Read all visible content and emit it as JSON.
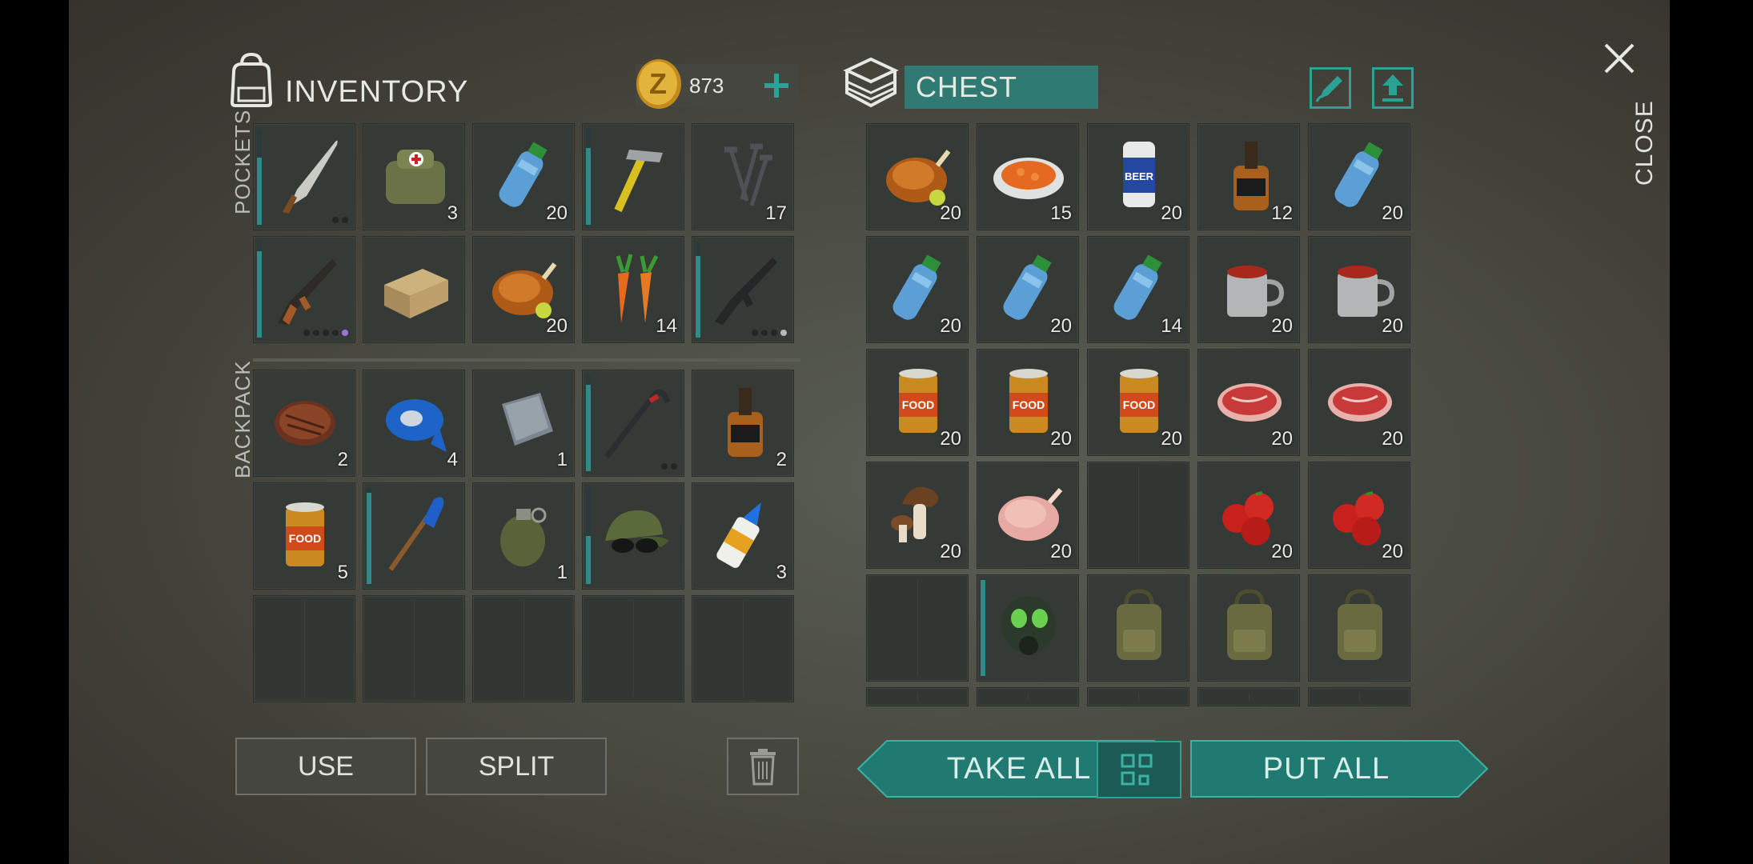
{
  "inventory": {
    "title": "INVENTORY",
    "coins": "873",
    "pockets_label": "POCKETS",
    "backpack_label": "BACKPACK",
    "pockets": [
      {
        "icon": "machete-icon",
        "count": "",
        "durability": 0.7,
        "dots": [
          "off",
          "off"
        ]
      },
      {
        "icon": "medkit-bag-icon",
        "count": "3"
      },
      {
        "icon": "water-bottle-icon",
        "count": "20"
      },
      {
        "icon": "hammer-icon",
        "count": "",
        "durability": 0.8
      },
      {
        "icon": "nails-icon",
        "count": "17"
      },
      {
        "icon": "ak-rifle-icon",
        "count": "",
        "durability": 0.9,
        "dots": [
          "off",
          "off",
          "off",
          "off",
          "purple"
        ]
      },
      {
        "icon": "mre-box-icon",
        "count": ""
      },
      {
        "icon": "roast-chicken-icon",
        "count": "20"
      },
      {
        "icon": "carrots-icon",
        "count": "14"
      },
      {
        "icon": "m16-rifle-icon",
        "count": "",
        "durability": 0.85,
        "dots": [
          "off",
          "off",
          "off",
          "on"
        ]
      }
    ],
    "backpack": [
      {
        "icon": "steak-icon",
        "count": "2"
      },
      {
        "icon": "duct-tape-icon",
        "count": "4"
      },
      {
        "icon": "metal-plate-icon",
        "count": "1"
      },
      {
        "icon": "crowbar-icon",
        "count": "",
        "durability": 0.9,
        "dots": [
          "off",
          "off"
        ]
      },
      {
        "icon": "whiskey-bottle-icon",
        "count": "2"
      },
      {
        "icon": "canned-food-icon",
        "count": "5"
      },
      {
        "icon": "paddle-icon",
        "count": "",
        "durability": 0.95
      },
      {
        "icon": "grenade-icon",
        "count": "1"
      },
      {
        "icon": "camo-cap-sunglasses-icon",
        "count": "",
        "durability": 0.5
      },
      {
        "icon": "glue-tube-icon",
        "count": "3"
      },
      {
        "icon": "",
        "count": ""
      },
      {
        "icon": "",
        "count": ""
      },
      {
        "icon": "",
        "count": ""
      },
      {
        "icon": "",
        "count": ""
      },
      {
        "icon": "",
        "count": ""
      }
    ],
    "buttons": {
      "use": "USE",
      "split": "SPLIT"
    }
  },
  "chest": {
    "title": "CHEST",
    "items": [
      {
        "icon": "roast-chicken-icon",
        "count": "20"
      },
      {
        "icon": "carrot-salad-plate-icon",
        "count": "15"
      },
      {
        "icon": "beer-can-icon",
        "count": "20"
      },
      {
        "icon": "whiskey-bottle-icon",
        "count": "12"
      },
      {
        "icon": "water-bottle-icon",
        "count": "20"
      },
      {
        "icon": "water-bottle-icon",
        "count": "20"
      },
      {
        "icon": "water-bottle-icon",
        "count": "20"
      },
      {
        "icon": "water-bottle-icon",
        "count": "14"
      },
      {
        "icon": "mug-soup-icon",
        "count": "20"
      },
      {
        "icon": "mug-soup-icon",
        "count": "20"
      },
      {
        "icon": "canned-food-icon",
        "count": "20"
      },
      {
        "icon": "canned-food-icon",
        "count": "20"
      },
      {
        "icon": "canned-food-icon",
        "count": "20"
      },
      {
        "icon": "raw-meat-icon",
        "count": "20"
      },
      {
        "icon": "raw-meat-icon",
        "count": "20"
      },
      {
        "icon": "mushrooms-icon",
        "count": "20"
      },
      {
        "icon": "raw-chicken-icon",
        "count": "20"
      },
      {
        "icon": "",
        "count": ""
      },
      {
        "icon": "tomatoes-icon",
        "count": "20"
      },
      {
        "icon": "tomatoes-icon",
        "count": "20"
      },
      {
        "icon": "",
        "count": ""
      },
      {
        "icon": "gas-mask-icon",
        "count": "",
        "durability": 1.0
      },
      {
        "icon": "backpack-icon",
        "count": ""
      },
      {
        "icon": "backpack-icon",
        "count": ""
      },
      {
        "icon": "backpack-icon",
        "count": ""
      }
    ],
    "buttons": {
      "take_all": "TAKE ALL",
      "put_all": "PUT ALL"
    }
  },
  "close_label": "CLOSE",
  "colors": {
    "teal": "#217a72",
    "teal_dark": "#1d5e58",
    "durability": "#2f8a8a",
    "gold": "#d9a42a"
  }
}
